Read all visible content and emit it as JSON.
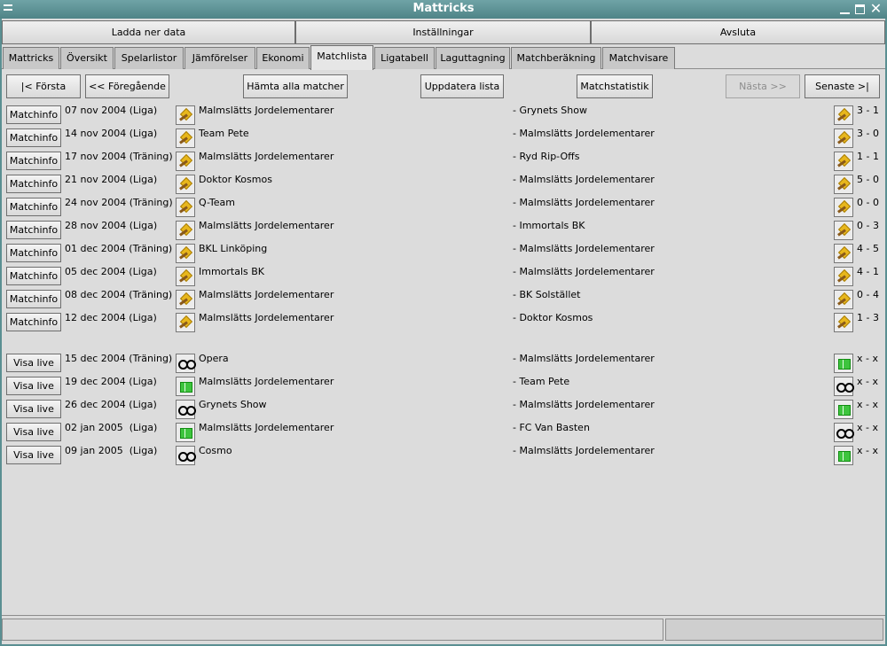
{
  "window": {
    "title": "Mattricks"
  },
  "topbar": {
    "download": "Ladda ner data",
    "settings": "Inställningar",
    "quit": "Avsluta"
  },
  "tabs": [
    "Mattricks",
    "Översikt",
    "Spelarlistor",
    "Jämförelser",
    "Ekonomi",
    "Matchlista",
    "Ligatabell",
    "Laguttagning",
    "Matchberäkning",
    "Matchvisare"
  ],
  "active_tab": "Matchlista",
  "toolbar": {
    "first": "|< Första",
    "prev": "<< Föregående",
    "fetch_all": "Hämta alla matcher",
    "update": "Uppdatera lista",
    "stats": "Matchstatistik",
    "next": "Nästa >>",
    "last": "Senaste >|"
  },
  "played_matches": [
    {
      "button": "Matchinfo",
      "date": "07 nov 2004",
      "type": "(Liga)",
      "home": "Malmslätts Jordelementarer",
      "away": "- Grynets Show",
      "score": "3 - 1"
    },
    {
      "button": "Matchinfo",
      "date": "14 nov 2004",
      "type": "(Liga)",
      "home": "Team Pete",
      "away": "- Malmslätts Jordelementarer",
      "score": "3 - 0"
    },
    {
      "button": "Matchinfo",
      "date": "17 nov 2004",
      "type": "(Träning)",
      "home": "Malmslätts Jordelementarer",
      "away": "- Ryd Rip-Offs",
      "score": "1 - 1"
    },
    {
      "button": "Matchinfo",
      "date": "21 nov 2004",
      "type": "(Liga)",
      "home": "Doktor Kosmos",
      "away": "- Malmslätts Jordelementarer",
      "score": "5 - 0"
    },
    {
      "button": "Matchinfo",
      "date": "24 nov 2004",
      "type": "(Träning)",
      "home": "Q-Team",
      "away": "- Malmslätts Jordelementarer",
      "score": "0 - 0"
    },
    {
      "button": "Matchinfo",
      "date": "28 nov 2004",
      "type": "(Liga)",
      "home": "Malmslätts Jordelementarer",
      "away": "- Immortals BK",
      "score": "0 - 3"
    },
    {
      "button": "Matchinfo",
      "date": "01 dec 2004",
      "type": "(Träning)",
      "home": "BKL Linköping",
      "away": "- Malmslätts Jordelementarer",
      "score": "4 - 5"
    },
    {
      "button": "Matchinfo",
      "date": "05 dec 2004",
      "type": "(Liga)",
      "home": "Immortals BK",
      "away": "- Malmslätts Jordelementarer",
      "score": "4 - 1"
    },
    {
      "button": "Matchinfo",
      "date": "08 dec 2004",
      "type": "(Träning)",
      "home": "Malmslätts Jordelementarer",
      "away": "- BK Solstället",
      "score": "0 - 4"
    },
    {
      "button": "Matchinfo",
      "date": "12 dec 2004",
      "type": "(Liga)",
      "home": "Malmslätts Jordelementarer",
      "away": "- Doktor Kosmos",
      "score": "1 - 3"
    }
  ],
  "upcoming_matches": [
    {
      "button": "Visa live",
      "date": "15 dec 2004",
      "type": "(Träning)",
      "home": "Opera",
      "away": "- Malmslätts Jordelementarer",
      "score": "x - x",
      "left_icon": "glasses-icon",
      "right_icon": "pitch-icon"
    },
    {
      "button": "Visa live",
      "date": "19 dec 2004",
      "type": "(Liga)",
      "home": "Malmslätts Jordelementarer",
      "away": "- Team Pete",
      "score": "x - x",
      "left_icon": "pitch-icon",
      "right_icon": "glasses-icon"
    },
    {
      "button": "Visa live",
      "date": "26 dec 2004",
      "type": "(Liga)",
      "home": "Grynets Show",
      "away": "- Malmslätts Jordelementarer",
      "score": "x - x",
      "left_icon": "glasses-icon",
      "right_icon": "pitch-icon"
    },
    {
      "button": "Visa live",
      "date": "02 jan 2005",
      "type": " (Liga)",
      "home": "Malmslätts Jordelementarer",
      "away": "- FC Van Basten",
      "score": "x - x",
      "left_icon": "pitch-icon",
      "right_icon": "glasses-icon"
    },
    {
      "button": "Visa live",
      "date": "09 jan 2005",
      "type": " (Liga)",
      "home": "Cosmo",
      "away": "- Malmslätts Jordelementarer",
      "score": "x - x",
      "left_icon": "glasses-icon",
      "right_icon": "pitch-icon"
    }
  ],
  "statusbar": {
    "left": "",
    "right": ""
  }
}
